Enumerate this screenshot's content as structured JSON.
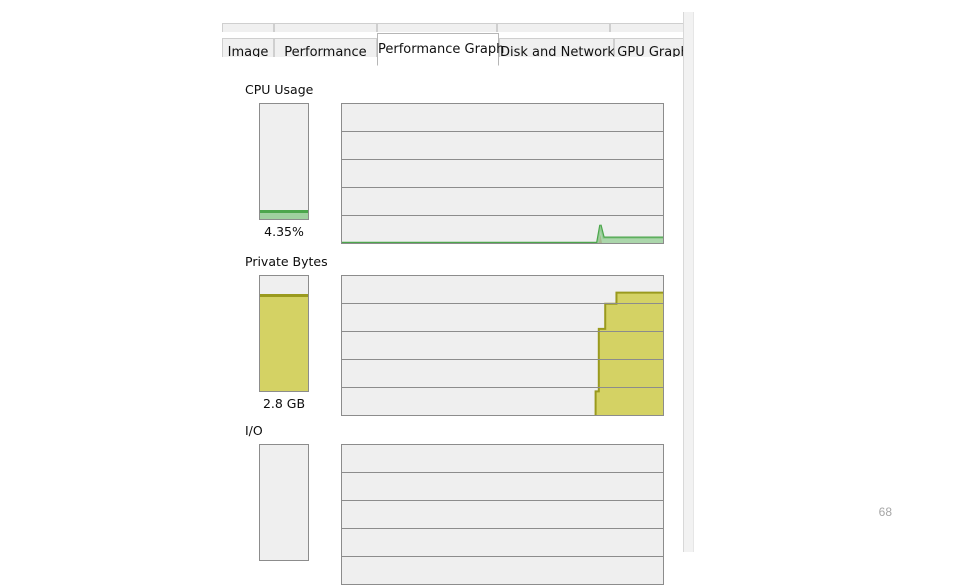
{
  "slide": {
    "page_number": "68",
    "page_number_color": "#a6a6a6"
  },
  "dialog": {
    "upper_tabs": [
      {
        "label": ""
      },
      {
        "label": ""
      },
      {
        "label": ""
      },
      {
        "label": ""
      },
      {
        "label": ""
      }
    ],
    "tabs": [
      {
        "label": "Image",
        "selected": false
      },
      {
        "label": "Performance",
        "selected": false
      },
      {
        "label": "Performance Graph",
        "selected": true
      },
      {
        "label": "Disk and Network",
        "selected": false
      },
      {
        "label": "GPU Graph",
        "selected": false
      }
    ]
  },
  "colors": {
    "cpu_line": "#4CA64C",
    "cpu_fill": "#9FD19F",
    "cpu_spike": "#CC2222",
    "private_line": "#9A9A1E",
    "private_fill": "#D4D264",
    "panel_bg": "#efefef",
    "panel_border": "#8c8c8c"
  },
  "sections": [
    {
      "label": "CPU Usage",
      "gauge": {
        "value_text": "4.35%",
        "fill_percent": 4.35,
        "fill_color": "#9FD19F",
        "line_color": "#4CA64C"
      },
      "graph": {
        "bands": 5,
        "series_name": "cpu-usage-history",
        "series_color": "#4CA64C",
        "kernel_color": "#CC2222",
        "values_percent": [
          0,
          0,
          0,
          0,
          0,
          0,
          0,
          0,
          0,
          0,
          0,
          0,
          0,
          0,
          0,
          0,
          0,
          0,
          0,
          0,
          0,
          0,
          0,
          0,
          0,
          0,
          0,
          0,
          0,
          0,
          0,
          0,
          0,
          0,
          0,
          0,
          0,
          0,
          0,
          0,
          0,
          0,
          0,
          0,
          0,
          0,
          0,
          0,
          0,
          0,
          0,
          0,
          0,
          0,
          0,
          0,
          0,
          0,
          0,
          0,
          0,
          0,
          0,
          0,
          0,
          0,
          0,
          0,
          0,
          0,
          0,
          0,
          0,
          0,
          0,
          0,
          0,
          0,
          0,
          0,
          13,
          4,
          4,
          4,
          4,
          4,
          4,
          4,
          4,
          4,
          4,
          4,
          4,
          4,
          4,
          4,
          4,
          4,
          4,
          4
        ],
        "spike_values_percent": [
          0,
          0,
          0,
          0,
          0,
          0,
          0,
          0,
          0,
          0,
          0,
          0,
          0,
          0,
          0,
          0,
          0,
          0,
          0,
          0,
          0,
          0,
          0,
          0,
          0,
          0,
          0,
          0,
          0,
          0,
          0,
          0,
          0,
          0,
          0,
          0,
          0,
          0,
          0,
          0,
          0,
          0,
          0,
          0,
          0,
          0,
          0,
          0,
          0,
          0,
          0,
          0,
          0,
          0,
          0,
          0,
          0,
          0,
          0,
          0,
          0,
          0,
          0,
          0,
          0,
          0,
          0,
          0,
          0,
          0,
          0,
          0,
          0,
          0,
          0,
          0,
          0,
          0,
          0,
          0,
          6,
          1,
          1,
          1,
          1,
          1,
          1,
          1,
          1,
          1,
          1,
          1,
          1,
          1,
          1,
          1,
          1,
          1,
          1,
          1
        ]
      }
    },
    {
      "label": "Private Bytes",
      "gauge": {
        "value_text": "2.8 GB",
        "fill_percent": 83,
        "fill_color": "#D4D264",
        "line_color": "#9A9A1E"
      },
      "graph": {
        "bands": 5,
        "series_name": "private-bytes-history",
        "series_color": "#9A9A1E",
        "fill_color": "#D4D264",
        "values_percent": [
          0,
          0,
          0,
          0,
          0,
          0,
          0,
          0,
          0,
          0,
          0,
          0,
          0,
          0,
          0,
          0,
          0,
          0,
          0,
          0,
          0,
          0,
          0,
          0,
          0,
          0,
          0,
          0,
          0,
          0,
          0,
          0,
          0,
          0,
          0,
          0,
          0,
          0,
          0,
          0,
          0,
          0,
          0,
          0,
          0,
          0,
          0,
          0,
          0,
          0,
          0,
          0,
          0,
          0,
          0,
          0,
          0,
          0,
          0,
          0,
          0,
          0,
          0,
          0,
          0,
          0,
          0,
          0,
          0,
          0,
          0,
          0,
          0,
          0,
          0,
          0,
          0,
          0,
          0,
          17,
          62,
          62,
          80,
          80,
          88,
          88,
          88,
          88,
          88,
          88,
          88,
          88,
          88,
          88,
          88,
          88,
          88,
          88,
          88,
          88
        ]
      }
    },
    {
      "label": "I/O",
      "gauge": {
        "value_text": "",
        "fill_percent": 0,
        "fill_color": "#8BC4E8",
        "line_color": "#2E7FB8"
      },
      "graph": {
        "bands": 5,
        "series_name": "io-history",
        "series_color": "#2E7FB8",
        "values_percent": [
          0,
          0,
          0,
          0,
          0,
          0,
          0,
          0,
          0,
          0,
          0,
          0,
          0,
          0,
          0,
          0,
          0,
          0,
          0,
          0,
          0,
          0,
          0,
          0,
          0,
          0,
          0,
          0,
          0,
          0,
          0,
          0,
          0,
          0,
          0,
          0,
          0,
          0,
          0,
          0
        ]
      }
    }
  ]
}
